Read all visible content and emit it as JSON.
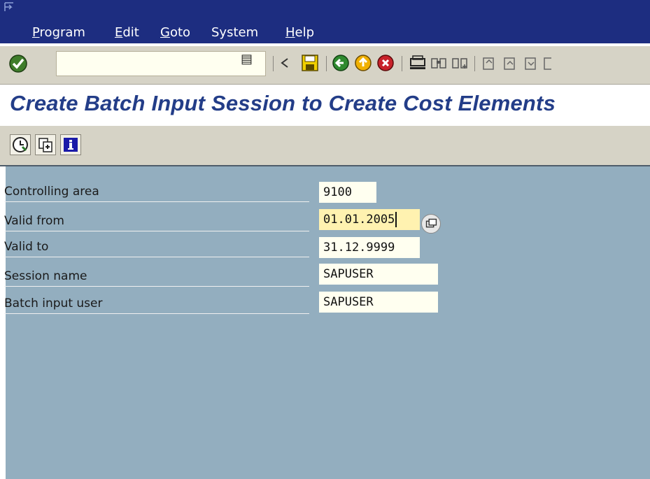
{
  "menubar": {
    "items": [
      {
        "label": "Program",
        "underline": "P",
        "rest": "rogram"
      },
      {
        "label": "Edit",
        "underline": "E",
        "rest": "dit"
      },
      {
        "label": "Goto",
        "underline": "G",
        "rest": "oto"
      },
      {
        "label": "System",
        "underline": "",
        "rest": "System"
      },
      {
        "label": "Help",
        "underline": "H",
        "rest": "elp"
      }
    ]
  },
  "toolbar": {
    "command_field_value": "",
    "dropdown_glyph": "▤"
  },
  "screen": {
    "title": "Create Batch Input Session to Create Cost Elements"
  },
  "form": {
    "rows": [
      {
        "label": "Controlling area",
        "value": "9100"
      },
      {
        "label": "Valid from",
        "value": "01.01.2005"
      },
      {
        "label": "Valid to",
        "value": "31.12.9999"
      },
      {
        "label": "Session name",
        "value": "SAPUSER"
      },
      {
        "label": "Batch input user",
        "value": "SAPUSER"
      }
    ]
  },
  "colors": {
    "menubar": "#1d2d80",
    "title": "#233d88",
    "content_bg": "#93aebf",
    "field_bg": "#fffff0",
    "focused_field_bg": "#fff2b0"
  }
}
